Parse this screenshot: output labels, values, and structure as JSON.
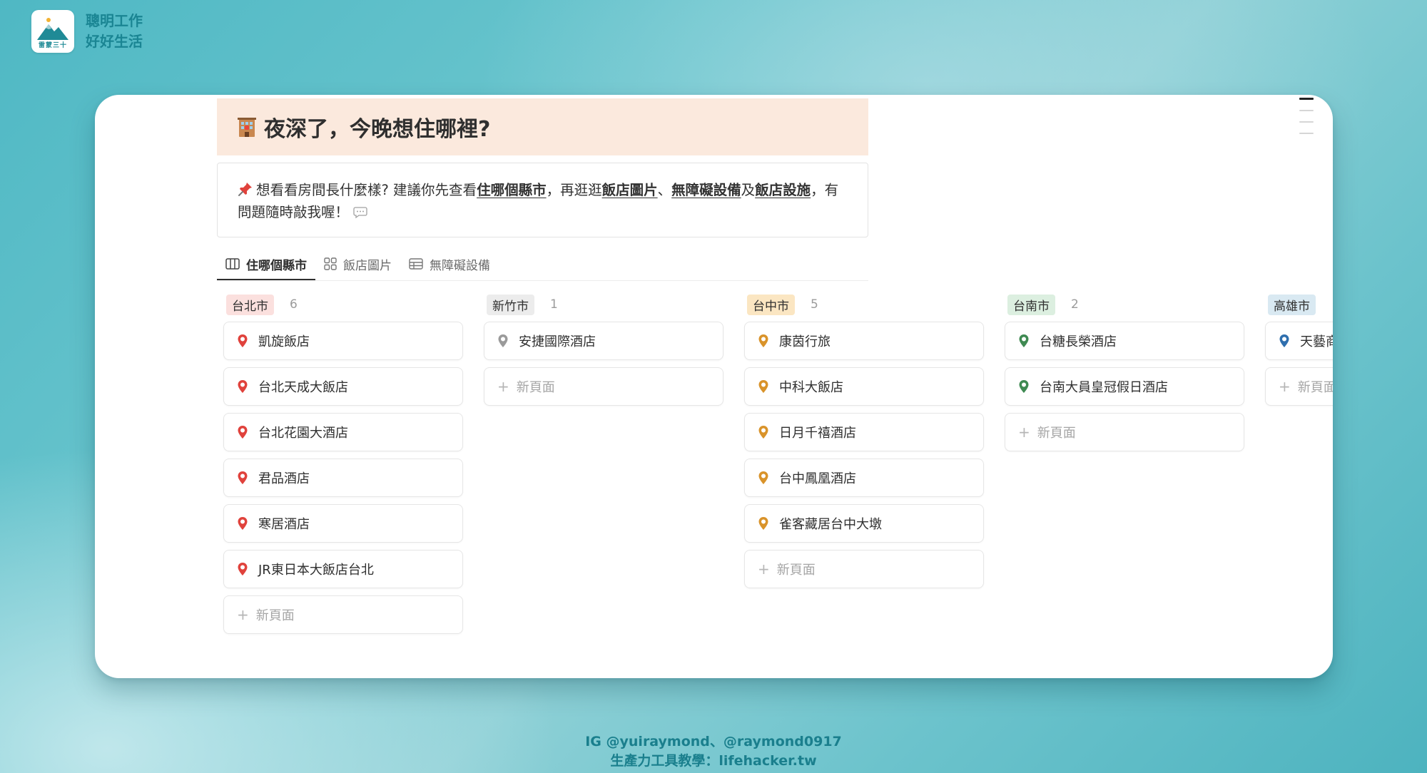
{
  "brand": {
    "line1": "聰明工作",
    "line2": "好好生活",
    "logo_text": "雷蒙三十"
  },
  "page": {
    "title": "夜深了，今晚想住哪裡?",
    "icon": "hotel-icon",
    "callout": {
      "icon": "pushpin-icon",
      "t1": "想看看房間長什麼樣? 建議你先查看",
      "link1": "住哪個縣市",
      "t2": "，再逛逛",
      "link2": "飯店圖片",
      "t3": "、",
      "link3": "無障礙設備",
      "t4": "及",
      "link4": "飯店設施",
      "t5": "，有問題隨時敲我喔！",
      "end_icon": "speech-bubble-icon"
    }
  },
  "tabs": [
    {
      "label": "住哪個縣市",
      "icon": "board-icon",
      "active": true
    },
    {
      "label": "飯店圖片",
      "icon": "gallery-icon",
      "active": false
    },
    {
      "label": "無障礙設備",
      "icon": "table-icon",
      "active": false
    }
  ],
  "new_page_label": "新頁面",
  "columns": [
    {
      "name": "台北市",
      "count": "6",
      "tag_bg": "#fbe0de",
      "pin_color": "#e0423c",
      "items": [
        "凱旋飯店",
        "台北天成大飯店",
        "台北花園大酒店",
        "君品酒店",
        "寒居酒店",
        "JR東日本大飯店台北"
      ]
    },
    {
      "name": "新竹市",
      "count": "1",
      "tag_bg": "#ececec",
      "pin_color": "#9a9a9a",
      "items": [
        "安捷國際酒店"
      ]
    },
    {
      "name": "台中市",
      "count": "5",
      "tag_bg": "#fbe6c2",
      "pin_color": "#d9932a",
      "items": [
        "康茵行旅",
        "中科大飯店",
        "日月千禧酒店",
        "台中鳳凰酒店",
        "雀客藏居台中大墩"
      ]
    },
    {
      "name": "台南市",
      "count": "2",
      "tag_bg": "#dcefe0",
      "pin_color": "#3f8a52",
      "items": [
        "台糖長榮酒店",
        "台南大員皇冠假日酒店"
      ]
    },
    {
      "name": "高雄市",
      "count": "",
      "tag_bg": "#d9e9f2",
      "pin_color": "#2f6fae",
      "items": [
        "天藝商"
      ]
    }
  ],
  "footer": {
    "line1": "IG @yuiraymond、@raymond0917",
    "line2": "生產力工具教學：lifehacker.tw"
  }
}
